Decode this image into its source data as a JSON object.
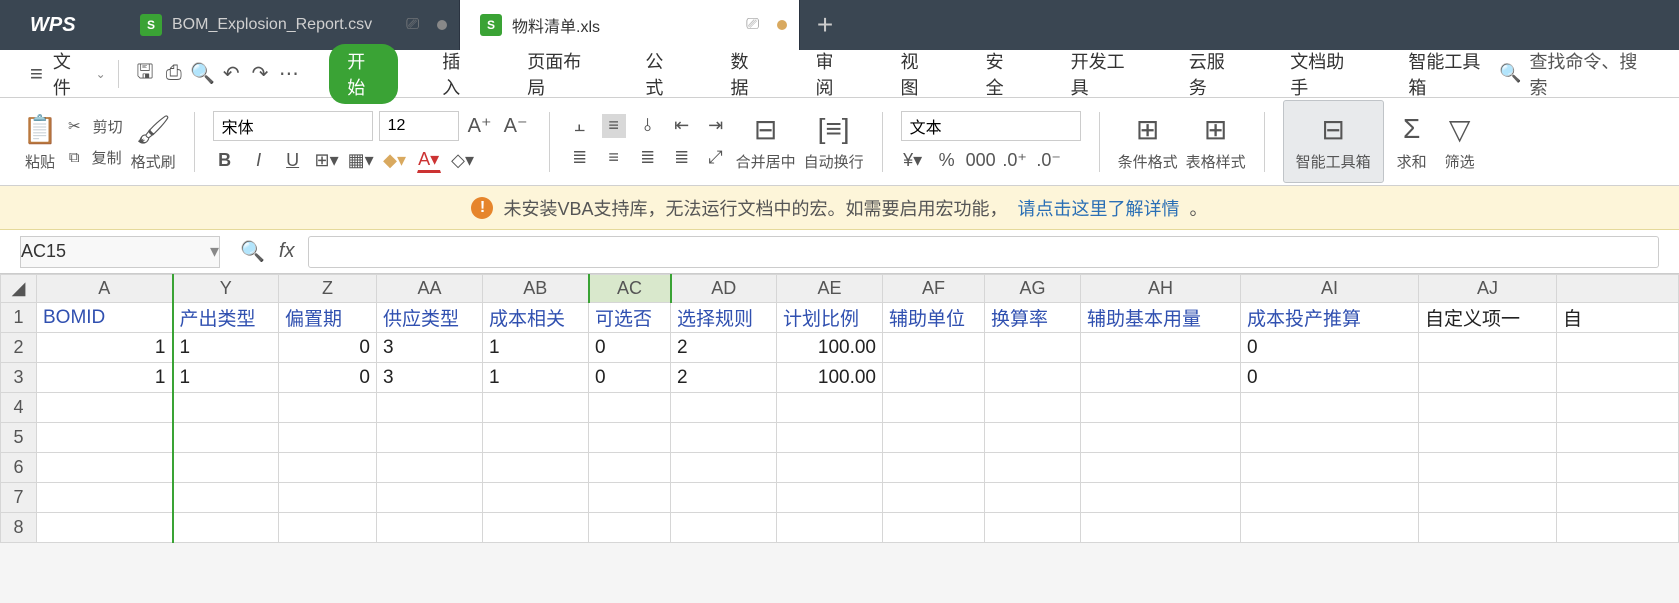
{
  "titlebar": {
    "logo": "WPS",
    "tabs": [
      {
        "icon": "S",
        "label": "BOM_Explosion_Report.csv",
        "active": false
      },
      {
        "icon": "S",
        "label": "物料清单.xls",
        "active": true
      }
    ],
    "newtab": "+"
  },
  "menubar": {
    "file_label": "文件",
    "ribbon_tabs": [
      "开始",
      "插入",
      "页面布局",
      "公式",
      "数据",
      "审阅",
      "视图",
      "安全",
      "开发工具",
      "云服务",
      "文档助手",
      "智能工具箱"
    ],
    "active_tab_index": 0,
    "search_placeholder": "查找命令、搜索"
  },
  "ribbon": {
    "paste": "粘贴",
    "cut": "剪切",
    "copy": "复制",
    "format_painter": "格式刷",
    "font_name": "宋体",
    "font_size": "12",
    "merge_center": "合并居中",
    "wrap_text": "自动换行",
    "number_format": "文本",
    "cond_format": "条件格式",
    "table_style": "表格样式",
    "smart_toolbox": "智能工具箱",
    "sum": "求和",
    "filter": "筛选"
  },
  "warnbar": {
    "text_before": "未安装VBA支持库，无法运行文档中的宏。如需要启用宏功能，",
    "link_text": "请点击这里了解详情",
    "text_after": "。"
  },
  "formulabar": {
    "namebox_value": "AC15",
    "fx_label": "fx",
    "formula_value": ""
  },
  "grid": {
    "columns": [
      "A",
      "Y",
      "Z",
      "AA",
      "AB",
      "AC",
      "AD",
      "AE",
      "AF",
      "AG",
      "AH",
      "AI",
      "AJ"
    ],
    "active_col": "AC",
    "header_row": [
      "BOMID",
      "产出类型",
      "偏置期",
      "供应类型",
      "成本相关",
      "可选否",
      "选择规则",
      "计划比例",
      "辅助单位",
      "换算率",
      "辅助基本用量",
      "成本投产推算",
      "自定义项一"
    ],
    "rows": [
      {
        "num": "1",
        "cells": [
          "1",
          "1",
          "0",
          "3",
          "1",
          "0",
          "2",
          "100.00",
          "",
          "",
          "",
          "0",
          ""
        ]
      },
      {
        "num": "2",
        "cells": [
          "1",
          "1",
          "0",
          "3",
          "1",
          "0",
          "2",
          "100.00",
          "",
          "",
          "",
          "0",
          ""
        ]
      }
    ],
    "extra_rownums": [
      "4",
      "5",
      "6",
      "7",
      "8"
    ],
    "last_frag": "自"
  }
}
